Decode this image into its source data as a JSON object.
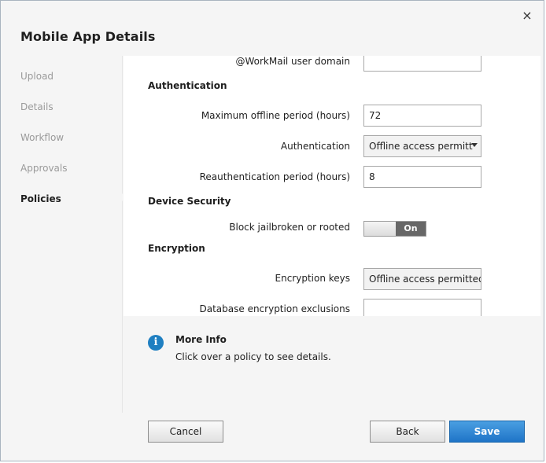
{
  "dialog": {
    "title": "Mobile App Details",
    "close_symbol": "×"
  },
  "sidebar": {
    "items": [
      {
        "label": "Upload",
        "active": false
      },
      {
        "label": "Details",
        "active": false
      },
      {
        "label": "Workflow",
        "active": false
      },
      {
        "label": "Approvals",
        "active": false
      },
      {
        "label": "Policies",
        "active": true
      }
    ]
  },
  "form": {
    "partial_label": "@WorkMail user domain",
    "partial_input_value": "",
    "authentication": {
      "section_title": "Authentication",
      "max_offline_label": "Maximum offline period (hours)",
      "max_offline_value": "72",
      "auth_label": "Authentication",
      "auth_value": "Offline access permitt",
      "reauth_label": "Reauthentication period (hours)",
      "reauth_value": "8"
    },
    "device_security": {
      "section_title": "Device Security",
      "block_label": "Block jailbroken or rooted",
      "toggle_label": "On"
    },
    "encryption": {
      "section_title": "Encryption",
      "keys_label": "Encryption keys",
      "keys_value": "Offline access permitted",
      "exclusions_label": "Database encryption exclusions",
      "exclusions_value": ""
    }
  },
  "info": {
    "icon_glyph": "i",
    "title": "More Info",
    "text": "Click over a policy to see details."
  },
  "buttons": {
    "cancel": "Cancel",
    "back": "Back",
    "save": "Save"
  },
  "colors": {
    "accent": "#1f74c7",
    "info_icon": "#1f7fc1",
    "toggle_on": "#676767"
  },
  "icons": {
    "close": "close-icon",
    "info": "info-icon",
    "dropdown": "chevron-down-icon"
  }
}
